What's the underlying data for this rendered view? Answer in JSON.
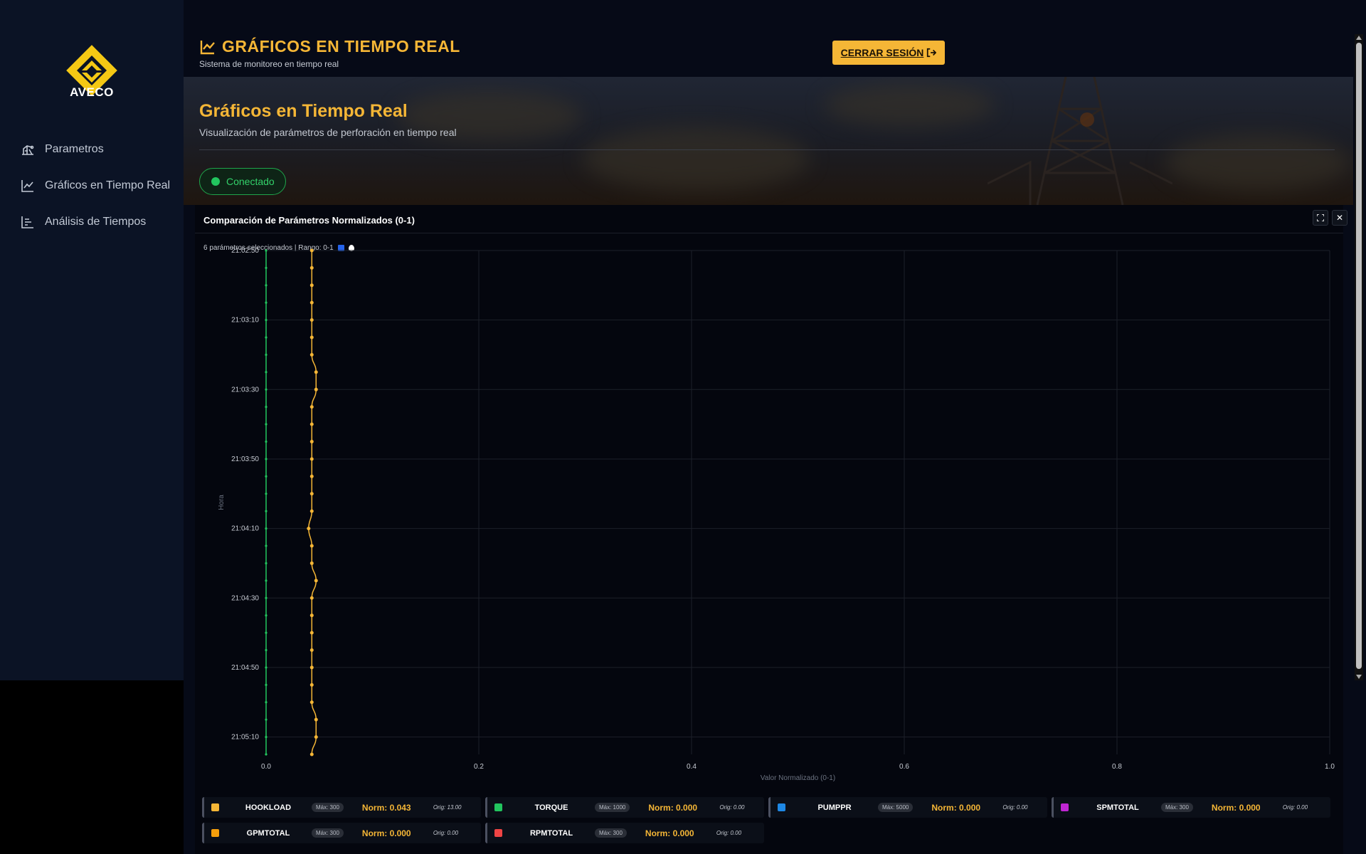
{
  "brand": {
    "name": "AVECO",
    "accent": "#f5b636"
  },
  "sidebar": {
    "items": [
      {
        "label": "Parametros",
        "icon": "pump-jack-icon"
      },
      {
        "label": "Gráficos en Tiempo Real",
        "icon": "line-chart-icon"
      },
      {
        "label": "Análisis de Tiempos",
        "icon": "bar-chart-icon"
      }
    ]
  },
  "header": {
    "title": "GRÁFICOS EN TIEMPO REAL",
    "subtitle": "Sistema de monitoreo en tiempo real",
    "logout_label": "CERRAR SESIÓN"
  },
  "page": {
    "title": "Gráficos en Tiempo Real",
    "subtitle": "Visualización de parámetros de perforación en tiempo real",
    "status": "Conectado"
  },
  "panel": {
    "title": "Comparación de Parámetros Normalizados (0-1)",
    "info": "6 parámetros seleccionados | Rango: 0-1"
  },
  "chart_data": {
    "type": "line",
    "orientation": "horizontal-time",
    "xlabel": "Valor Normalizado (0-1)",
    "ylabel": "Hora",
    "xlim": [
      0,
      1
    ],
    "x_ticks": [
      "0.0",
      "0.2",
      "0.4",
      "0.6",
      "0.8",
      "1.0"
    ],
    "y_ticks": [
      "21:02:50",
      "21:03:10",
      "21:03:30",
      "21:03:50",
      "21:04:10",
      "21:04:30",
      "21:04:50",
      "21:05:10"
    ],
    "times": [
      "21:02:50",
      "21:02:55",
      "21:03:00",
      "21:03:05",
      "21:03:10",
      "21:03:15",
      "21:03:20",
      "21:03:25",
      "21:03:30",
      "21:03:35",
      "21:03:40",
      "21:03:45",
      "21:03:50",
      "21:03:55",
      "21:04:00",
      "21:04:05",
      "21:04:10",
      "21:04:15",
      "21:04:20",
      "21:04:25",
      "21:04:30",
      "21:04:35",
      "21:04:40",
      "21:04:45",
      "21:04:50",
      "21:04:55",
      "21:05:00",
      "21:05:05",
      "21:05:10",
      "21:05:15"
    ],
    "grid": true,
    "series": [
      {
        "name": "HOOKLOAD",
        "color": "#f5b636",
        "values": [
          0.043,
          0.043,
          0.043,
          0.043,
          0.043,
          0.043,
          0.043,
          0.047,
          0.047,
          0.043,
          0.043,
          0.043,
          0.043,
          0.043,
          0.043,
          0.043,
          0.04,
          0.043,
          0.043,
          0.047,
          0.043,
          0.043,
          0.043,
          0.043,
          0.043,
          0.043,
          0.043,
          0.047,
          0.047,
          0.043
        ]
      },
      {
        "name": "TORQUE",
        "color": "#22c55e",
        "values": [
          0,
          0,
          0,
          0,
          0,
          0,
          0,
          0,
          0,
          0,
          0,
          0,
          0,
          0,
          0,
          0,
          0,
          0,
          0,
          0,
          0,
          0,
          0,
          0,
          0,
          0,
          0,
          0,
          0,
          0
        ]
      }
    ]
  },
  "legend": [
    {
      "name": "HOOKLOAD",
      "max": "Máx: 300",
      "norm": "Norm: 0.043",
      "orig": "Orig: 13.00",
      "color": "#f5b636"
    },
    {
      "name": "TORQUE",
      "max": "Máx: 1000",
      "norm": "Norm: 0.000",
      "orig": "Orig: 0.00",
      "color": "#22c55e"
    },
    {
      "name": "PUMPPR",
      "max": "Máx: 5000",
      "norm": "Norm: 0.000",
      "orig": "Orig: 0.00",
      "color": "#1e88e5"
    },
    {
      "name": "SPMTOTAL",
      "max": "Máx: 300",
      "norm": "Norm: 0.000",
      "orig": "Orig: 0.00",
      "color": "#c026d3"
    },
    {
      "name": "GPMTOTAL",
      "max": "Máx: 300",
      "norm": "Norm: 0.000",
      "orig": "Orig: 0.00",
      "color": "#f59e0b"
    },
    {
      "name": "RPMTOTAL",
      "max": "Máx: 300",
      "norm": "Norm: 0.000",
      "orig": "Orig: 0.00",
      "color": "#ef4444"
    }
  ]
}
